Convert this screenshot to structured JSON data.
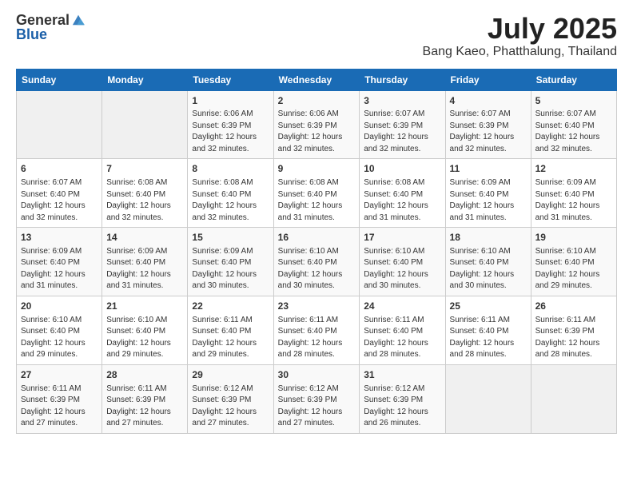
{
  "header": {
    "logo_general": "General",
    "logo_blue": "Blue",
    "month": "July 2025",
    "location": "Bang Kaeo, Phatthalung, Thailand"
  },
  "days_of_week": [
    "Sunday",
    "Monday",
    "Tuesday",
    "Wednesday",
    "Thursday",
    "Friday",
    "Saturday"
  ],
  "weeks": [
    [
      {
        "day": "",
        "info": ""
      },
      {
        "day": "",
        "info": ""
      },
      {
        "day": "1",
        "info": "Sunrise: 6:06 AM\nSunset: 6:39 PM\nDaylight: 12 hours and 32 minutes."
      },
      {
        "day": "2",
        "info": "Sunrise: 6:06 AM\nSunset: 6:39 PM\nDaylight: 12 hours and 32 minutes."
      },
      {
        "day": "3",
        "info": "Sunrise: 6:07 AM\nSunset: 6:39 PM\nDaylight: 12 hours and 32 minutes."
      },
      {
        "day": "4",
        "info": "Sunrise: 6:07 AM\nSunset: 6:39 PM\nDaylight: 12 hours and 32 minutes."
      },
      {
        "day": "5",
        "info": "Sunrise: 6:07 AM\nSunset: 6:40 PM\nDaylight: 12 hours and 32 minutes."
      }
    ],
    [
      {
        "day": "6",
        "info": "Sunrise: 6:07 AM\nSunset: 6:40 PM\nDaylight: 12 hours and 32 minutes."
      },
      {
        "day": "7",
        "info": "Sunrise: 6:08 AM\nSunset: 6:40 PM\nDaylight: 12 hours and 32 minutes."
      },
      {
        "day": "8",
        "info": "Sunrise: 6:08 AM\nSunset: 6:40 PM\nDaylight: 12 hours and 32 minutes."
      },
      {
        "day": "9",
        "info": "Sunrise: 6:08 AM\nSunset: 6:40 PM\nDaylight: 12 hours and 31 minutes."
      },
      {
        "day": "10",
        "info": "Sunrise: 6:08 AM\nSunset: 6:40 PM\nDaylight: 12 hours and 31 minutes."
      },
      {
        "day": "11",
        "info": "Sunrise: 6:09 AM\nSunset: 6:40 PM\nDaylight: 12 hours and 31 minutes."
      },
      {
        "day": "12",
        "info": "Sunrise: 6:09 AM\nSunset: 6:40 PM\nDaylight: 12 hours and 31 minutes."
      }
    ],
    [
      {
        "day": "13",
        "info": "Sunrise: 6:09 AM\nSunset: 6:40 PM\nDaylight: 12 hours and 31 minutes."
      },
      {
        "day": "14",
        "info": "Sunrise: 6:09 AM\nSunset: 6:40 PM\nDaylight: 12 hours and 31 minutes."
      },
      {
        "day": "15",
        "info": "Sunrise: 6:09 AM\nSunset: 6:40 PM\nDaylight: 12 hours and 30 minutes."
      },
      {
        "day": "16",
        "info": "Sunrise: 6:10 AM\nSunset: 6:40 PM\nDaylight: 12 hours and 30 minutes."
      },
      {
        "day": "17",
        "info": "Sunrise: 6:10 AM\nSunset: 6:40 PM\nDaylight: 12 hours and 30 minutes."
      },
      {
        "day": "18",
        "info": "Sunrise: 6:10 AM\nSunset: 6:40 PM\nDaylight: 12 hours and 30 minutes."
      },
      {
        "day": "19",
        "info": "Sunrise: 6:10 AM\nSunset: 6:40 PM\nDaylight: 12 hours and 29 minutes."
      }
    ],
    [
      {
        "day": "20",
        "info": "Sunrise: 6:10 AM\nSunset: 6:40 PM\nDaylight: 12 hours and 29 minutes."
      },
      {
        "day": "21",
        "info": "Sunrise: 6:10 AM\nSunset: 6:40 PM\nDaylight: 12 hours and 29 minutes."
      },
      {
        "day": "22",
        "info": "Sunrise: 6:11 AM\nSunset: 6:40 PM\nDaylight: 12 hours and 29 minutes."
      },
      {
        "day": "23",
        "info": "Sunrise: 6:11 AM\nSunset: 6:40 PM\nDaylight: 12 hours and 28 minutes."
      },
      {
        "day": "24",
        "info": "Sunrise: 6:11 AM\nSunset: 6:40 PM\nDaylight: 12 hours and 28 minutes."
      },
      {
        "day": "25",
        "info": "Sunrise: 6:11 AM\nSunset: 6:40 PM\nDaylight: 12 hours and 28 minutes."
      },
      {
        "day": "26",
        "info": "Sunrise: 6:11 AM\nSunset: 6:39 PM\nDaylight: 12 hours and 28 minutes."
      }
    ],
    [
      {
        "day": "27",
        "info": "Sunrise: 6:11 AM\nSunset: 6:39 PM\nDaylight: 12 hours and 27 minutes."
      },
      {
        "day": "28",
        "info": "Sunrise: 6:11 AM\nSunset: 6:39 PM\nDaylight: 12 hours and 27 minutes."
      },
      {
        "day": "29",
        "info": "Sunrise: 6:12 AM\nSunset: 6:39 PM\nDaylight: 12 hours and 27 minutes."
      },
      {
        "day": "30",
        "info": "Sunrise: 6:12 AM\nSunset: 6:39 PM\nDaylight: 12 hours and 27 minutes."
      },
      {
        "day": "31",
        "info": "Sunrise: 6:12 AM\nSunset: 6:39 PM\nDaylight: 12 hours and 26 minutes."
      },
      {
        "day": "",
        "info": ""
      },
      {
        "day": "",
        "info": ""
      }
    ]
  ]
}
